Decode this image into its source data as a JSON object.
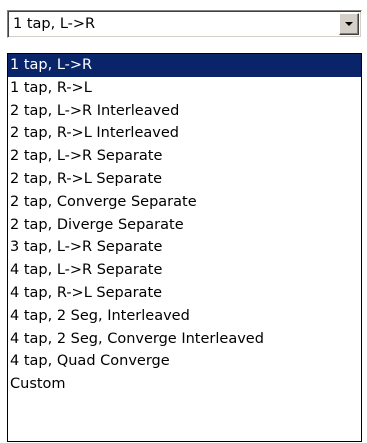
{
  "combo": {
    "value": "1 tap, L->R",
    "button_icon": "chevron-down-icon"
  },
  "dropdown": {
    "selected_index": 0,
    "highlight_color": "#0a246a",
    "options": [
      "1 tap, L->R",
      "1 tap, R->L",
      "2 tap, L->R Interleaved",
      "2 tap, R->L Interleaved",
      "2 tap, L->R Separate",
      "2 tap, R->L Separate",
      "2 tap, Converge Separate",
      "2 tap, Diverge Separate",
      "3 tap, L->R Separate",
      "4 tap, L->R Separate",
      "4 tap, R->L Separate",
      "4 tap, 2 Seg, Interleaved",
      "4 tap, 2 Seg, Converge Interleaved",
      "4 tap, Quad Converge",
      "Custom"
    ]
  }
}
